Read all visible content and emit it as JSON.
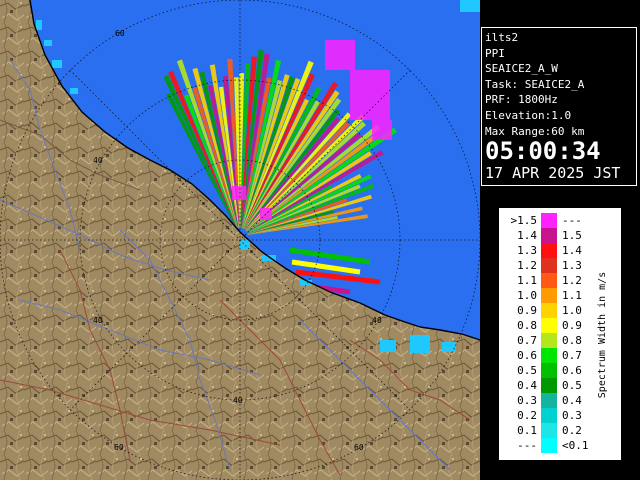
{
  "info": {
    "station": "ilts2",
    "scan_type": "PPI",
    "product": "SEAICE2_A_W",
    "task": "Task: SEAICE2_A",
    "prf": "PRF: 1800Hz",
    "elevation": "Elevation:1.0",
    "max_range": "Max Range:60 km",
    "time": "05:00:34",
    "date": "17 APR 2025 JST"
  },
  "map": {
    "range_labels": [
      "60",
      "40",
      "40",
      "40",
      "40",
      "60",
      "60"
    ],
    "colors": {
      "sea": "#2a6ff0",
      "land": "#a08a62",
      "coast_ice": "#1fc8ff"
    }
  },
  "legend": {
    "title": "Spectrum Width in m/s",
    "rows": [
      {
        "left": ">1.5",
        "right": "---",
        "color": "#ff22ff"
      },
      {
        "left": "1.4",
        "right": "1.5",
        "color": "#c8148c"
      },
      {
        "left": "1.3",
        "right": "1.4",
        "color": "#ff1010"
      },
      {
        "left": "1.2",
        "right": "1.3",
        "color": "#e03020"
      },
      {
        "left": "1.1",
        "right": "1.2",
        "color": "#ff5a14"
      },
      {
        "left": "1.0",
        "right": "1.1",
        "color": "#ff9a00"
      },
      {
        "left": "0.9",
        "right": "1.0",
        "color": "#ffd200"
      },
      {
        "left": "0.8",
        "right": "0.9",
        "color": "#ffff00"
      },
      {
        "left": "0.7",
        "right": "0.8",
        "color": "#b4e61e"
      },
      {
        "left": "0.6",
        "right": "0.7",
        "color": "#00e600"
      },
      {
        "left": "0.5",
        "right": "0.6",
        "color": "#00c000"
      },
      {
        "left": "0.4",
        "right": "0.5",
        "color": "#009a00"
      },
      {
        "left": "0.3",
        "right": "0.4",
        "color": "#14b4a0"
      },
      {
        "left": "0.2",
        "right": "0.3",
        "color": "#00d2d2"
      },
      {
        "left": "0.1",
        "right": "0.2",
        "color": "#1ee6e6"
      },
      {
        "left": "---",
        "right": "<0.1",
        "color": "#00ffff"
      }
    ]
  }
}
